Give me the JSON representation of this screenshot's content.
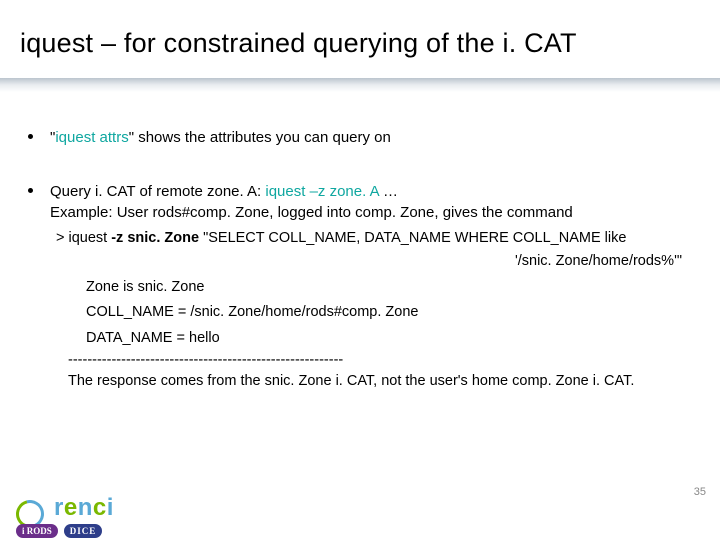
{
  "title": "iquest – for constrained querying of the i. CAT",
  "bullet1": {
    "pre": "\"",
    "cmd": "iquest attrs",
    "post": "\" shows the attributes you can query on"
  },
  "bullet2": {
    "line1_pre": "Query i. CAT of remote zone. A: ",
    "line1_cmd": "iquest  –z  zone. A",
    "line1_post": " …",
    "line2": "Example: User rods#comp. Zone, logged into comp. Zone, gives the command"
  },
  "cmd": {
    "prompt_pre": "> iquest ",
    "flag": "-z snic. Zone",
    "rest1": " \"SELECT COLL_NAME, DATA_NAME WHERE COLL_NAME like",
    "rest2": "'/snic. Zone/home/rods%'\""
  },
  "output": {
    "l1": "Zone is snic. Zone",
    "l2": "COLL_NAME = /snic. Zone/home/rods#comp. Zone",
    "l3": "DATA_NAME = hello"
  },
  "dashes": "---------------------------------------------------------",
  "note": "The response comes from the snic. Zone i. CAT, not the user's home comp. Zone i. CAT.",
  "pagenum": "35",
  "footer": {
    "irods": "i RODS",
    "dice": "DICE"
  }
}
